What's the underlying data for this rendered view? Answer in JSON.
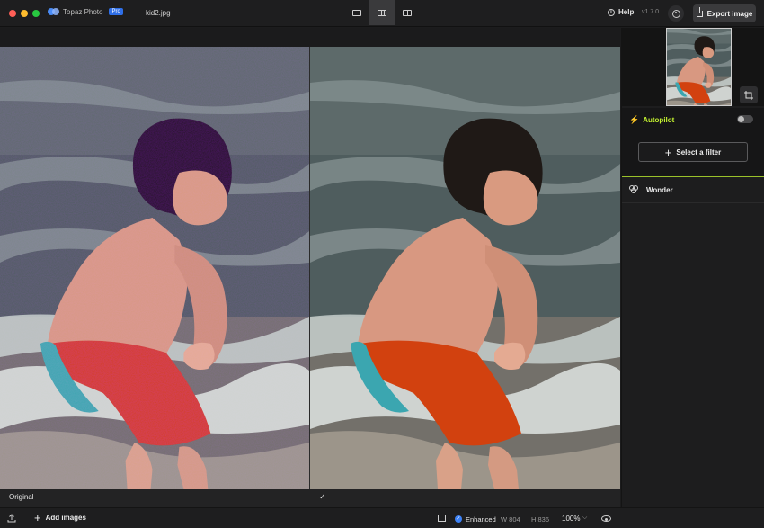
{
  "window": {
    "app_name": "Topaz Photo",
    "badge": "Pro",
    "filename": "kid2.jpg",
    "version": "v1.7.0"
  },
  "toolbar": {
    "view_modes": [
      "single-view",
      "split-view",
      "side-by-side-view"
    ],
    "active_view": "split-view",
    "help_label": "Help",
    "export_label": "Export image"
  },
  "canvas": {
    "original_label": "Original",
    "check_glyph": "✓"
  },
  "bottom": {
    "add_images_label": "Add images",
    "enhanced_label": "Enhanced",
    "width_text": "W 804",
    "height_text": "H 836",
    "zoom_text": "100%"
  },
  "sidebar": {
    "autopilot_label": "Autopilot",
    "autopilot_enabled": false,
    "select_filter_label": "Select a filter",
    "filter_item_label": "Wonder"
  },
  "colors": {
    "accent_green": "#c4f230",
    "accent_blue": "#3d82f6",
    "shorts_orange": "#d2410f",
    "shorts_teal": "#3ba6b0"
  },
  "icons": [
    "upload-icon",
    "plus-icon",
    "fit-icon",
    "check-icon",
    "chevron-down-icon",
    "eye-icon",
    "crop-icon",
    "bolt-icon",
    "help-icon",
    "account-icon",
    "export-icon",
    "wonder-icon"
  ]
}
